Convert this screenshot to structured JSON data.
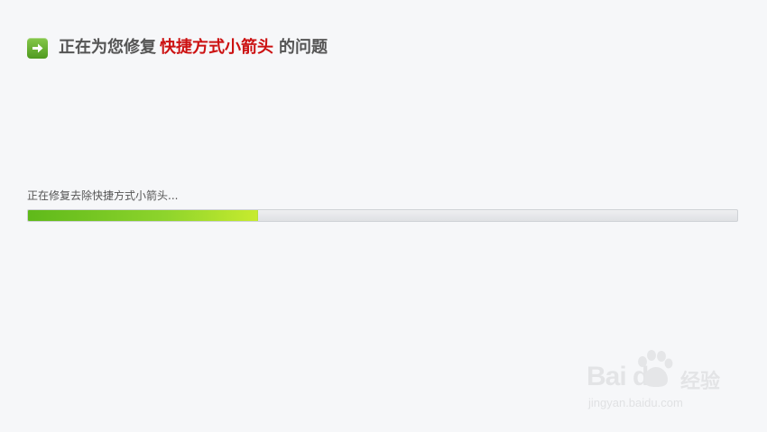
{
  "header": {
    "icon": "arrow-right-icon",
    "title_prefix": "正在为您修复",
    "title_highlight": "快捷方式小箭头",
    "title_suffix": "的问题"
  },
  "status": {
    "text": "正在修复去除快捷方式小箭头..."
  },
  "progress": {
    "percent": 32.5
  },
  "watermark": {
    "brand": "Bai du",
    "product": "经验",
    "url": "jingyan.baidu.com"
  },
  "colors": {
    "highlight": "#cc1111",
    "progress_fill": "#8ad42a",
    "icon_bg": "#6ab334",
    "background": "#f6f7f9"
  }
}
